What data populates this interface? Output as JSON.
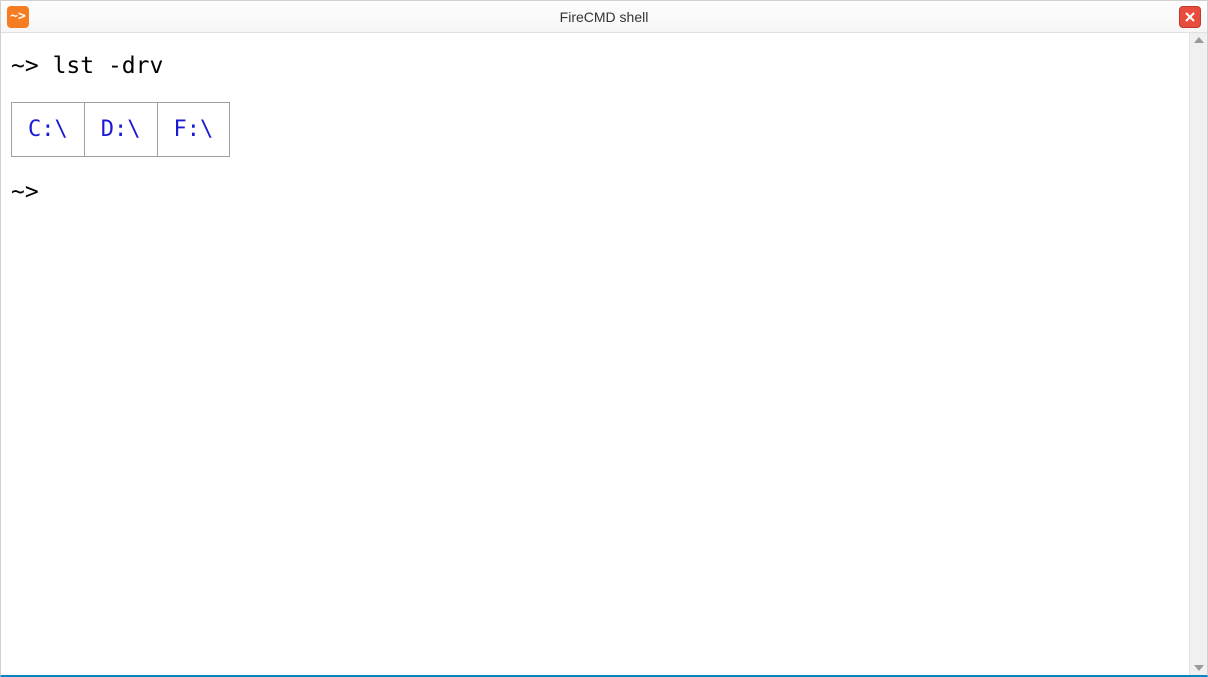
{
  "window": {
    "title": "FireCMD shell",
    "app_icon_glyph": "~>"
  },
  "terminal": {
    "prompt": "~>",
    "command": "lst -drv",
    "drives": [
      "C:\\",
      "D:\\",
      "F:\\"
    ]
  }
}
